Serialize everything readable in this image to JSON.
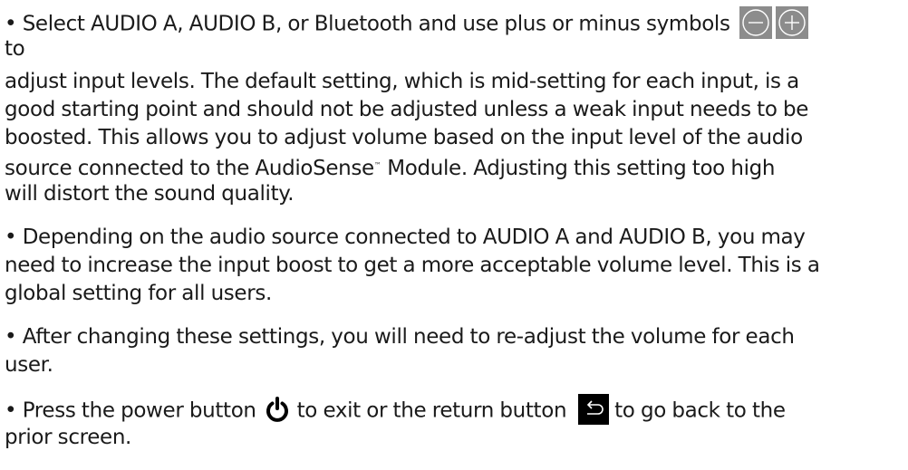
{
  "bullet": "•",
  "paragraph1": {
    "line1": "Select AUDIO A, AUDIO B, or Bluetooth and use plus or minus symbols",
    "line2": "to",
    "line3": "adjust input levels.  The default setting, which is mid-setting for each input, is a",
    "line4": "good starting point and should not be adjusted unless a weak input needs to be",
    "line5": "boosted. This allows you to adjust volume based on the input level of the audio",
    "line6_before": "source connected to the AudioSense",
    "trademark": "™",
    "line6_after": " Module. Adjusting this setting too high",
    "line7": "will distort the sound quality."
  },
  "paragraph2": {
    "line1": "Depending on the audio source connected to AUDIO A and AUDIO B, you may",
    "line2": "need to increase the input boost to get a more acceptable volume level. This is a",
    "line3": "global setting for all users."
  },
  "paragraph3": {
    "line1": "After changing these settings, you will need to re-adjust the volume for each",
    "line2": "user."
  },
  "paragraph4": {
    "line1_a": "Press the power button",
    "line1_b": "to exit or the return button",
    "line1_c": "to go back to the",
    "line2": "prior screen."
  },
  "icons": {
    "minus": "minus-circle-icon",
    "plus": "plus-circle-icon",
    "power": "power-icon",
    "return": "return-arrow-icon"
  },
  "colors": {
    "text": "#1a1a1a",
    "icon_box_fill": "#8c8c8c",
    "return_icon_bg": "#000000"
  }
}
